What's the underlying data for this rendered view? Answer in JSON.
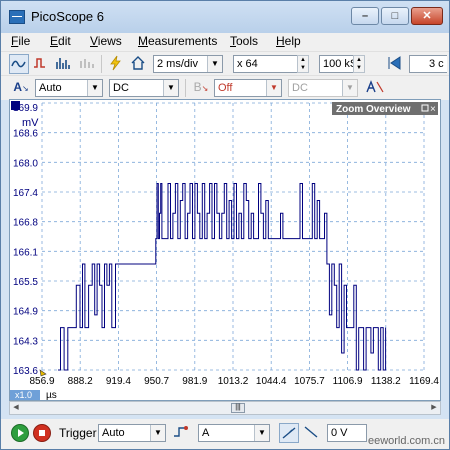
{
  "window": {
    "title": "PicoScope 6"
  },
  "menu": [
    {
      "label": "File",
      "u": "F",
      "rest": "ile"
    },
    {
      "label": "Edit",
      "u": "E",
      "rest": "dit"
    },
    {
      "label": "Views",
      "u": "V",
      "rest": "iews"
    },
    {
      "label": "Measurements",
      "u": "M",
      "rest": "easurements"
    },
    {
      "label": "Tools",
      "u": "T",
      "rest": "ools"
    },
    {
      "label": "Help",
      "u": "H",
      "rest": "elp"
    }
  ],
  "toolbar1": {
    "timebase": "2 ms/div",
    "multiplier": "x 64",
    "samples": "100 kS",
    "capture_count_partial": "3 c"
  },
  "toolbar2": {
    "channel": "A",
    "range": "Auto",
    "coupling": "DC",
    "channel_b": "B",
    "probe_b": "Off",
    "coupling_b": "DC"
  },
  "scope": {
    "zoom_overview_label": "Zoom Overview",
    "y_unit": "mV",
    "x_unit": "µs",
    "zoom_factor": "x1.0",
    "y_ticks": [
      "169.9",
      "168.6",
      "168.0",
      "167.4",
      "166.8",
      "166.1",
      "165.5",
      "164.9",
      "164.3",
      "163.6"
    ],
    "x_ticks": [
      "856.9",
      "888.2",
      "919.4",
      "950.7",
      "981.9",
      "1013.2",
      "1044.4",
      "1075.7",
      "1106.9",
      "1138.2",
      "1169.4"
    ],
    "trace_color": "#00007f",
    "grid_color": "#7fa9d9"
  },
  "chart_data": {
    "type": "line",
    "xlabel": "µs",
    "ylabel": "mV",
    "xlim": [
      856.9,
      1169.4
    ],
    "ylim": [
      163.6,
      169.9
    ],
    "series": [
      {
        "x": [
          870,
          872,
          875,
          878,
          880,
          883,
          885,
          888,
          890,
          892,
          895,
          898,
          900,
          902,
          904,
          906,
          908,
          910,
          912,
          914,
          917,
          920,
          923,
          926,
          929,
          932,
          935,
          938,
          941,
          944,
          947,
          950,
          951,
          952,
          953,
          954,
          955,
          956,
          958,
          960,
          962,
          964,
          966,
          968,
          970,
          972,
          974,
          976,
          978,
          980,
          982,
          984,
          986,
          988,
          990,
          992,
          994,
          996,
          998,
          1000,
          1002,
          1004,
          1006,
          1008,
          1010,
          1012,
          1014,
          1016,
          1018,
          1020,
          1022,
          1024,
          1026,
          1028,
          1030,
          1032,
          1034,
          1036,
          1038,
          1040,
          1042,
          1044,
          1046,
          1048,
          1050,
          1052,
          1054,
          1056,
          1058,
          1060,
          1062,
          1064,
          1066,
          1068,
          1070,
          1072,
          1074,
          1076,
          1078,
          1080,
          1082,
          1084,
          1086,
          1088,
          1090,
          1092,
          1094,
          1096,
          1098,
          1100,
          1102,
          1104,
          1106,
          1108,
          1110,
          1112,
          1114,
          1116,
          1118,
          1120,
          1122,
          1124,
          1126,
          1128,
          1130,
          1132,
          1134,
          1136,
          1138
        ],
        "y": [
          163.6,
          164.6,
          163.6,
          164.6,
          164.6,
          164.6,
          165.6,
          164.6,
          166.1,
          164.6,
          165.6,
          166.1,
          164.9,
          166.1,
          165.6,
          164.6,
          166.1,
          165.6,
          166.1,
          164.6,
          166.1,
          166.1,
          166.1,
          166.1,
          166.1,
          166.1,
          166.1,
          166.1,
          166.1,
          166.1,
          166.1,
          166.7,
          168.0,
          166.7,
          167.3,
          168.0,
          166.7,
          166.7,
          166.7,
          168.0,
          166.7,
          167.3,
          168.0,
          166.7,
          167.6,
          168.0,
          166.7,
          167.3,
          168.0,
          166.7,
          168.0,
          167.3,
          166.7,
          168.0,
          166.7,
          167.3,
          168.0,
          166.7,
          168.0,
          167.3,
          166.7,
          167.3,
          168.0,
          166.7,
          167.6,
          166.7,
          168.0,
          166.7,
          167.3,
          166.7,
          168.0,
          167.6,
          166.7,
          167.3,
          166.7,
          166.7,
          168.0,
          167.3,
          166.7,
          167.6,
          166.7,
          166.7,
          166.7,
          166.7,
          166.7,
          167.3,
          166.7,
          166.7,
          166.7,
          166.7,
          166.7,
          166.7,
          166.7,
          168.0,
          166.7,
          166.7,
          166.7,
          166.7,
          168.0,
          166.7,
          167.6,
          166.7,
          166.7,
          167.3,
          166.1,
          164.9,
          166.1,
          165.6,
          164.6,
          166.1,
          164.0,
          165.6,
          164.6,
          164.6,
          164.6,
          165.6,
          163.6,
          164.6,
          164.6,
          163.6,
          164.6,
          164.6,
          164.0,
          164.6,
          164.6,
          163.6,
          164.6,
          163.6,
          164.6
        ]
      }
    ]
  }
}
